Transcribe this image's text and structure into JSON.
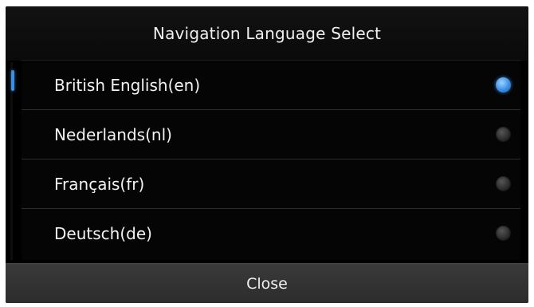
{
  "dialog": {
    "title": "Navigation Language Select",
    "close_label": "Close"
  },
  "languages": [
    {
      "label": "British English(en)",
      "selected": true
    },
    {
      "label": "Nederlands(nl)",
      "selected": false
    },
    {
      "label": "Français(fr)",
      "selected": false
    },
    {
      "label": "Deutsch(de)",
      "selected": false
    }
  ],
  "colors": {
    "accent": "#3a90e6",
    "background": "#000000",
    "footer": "#333333"
  }
}
